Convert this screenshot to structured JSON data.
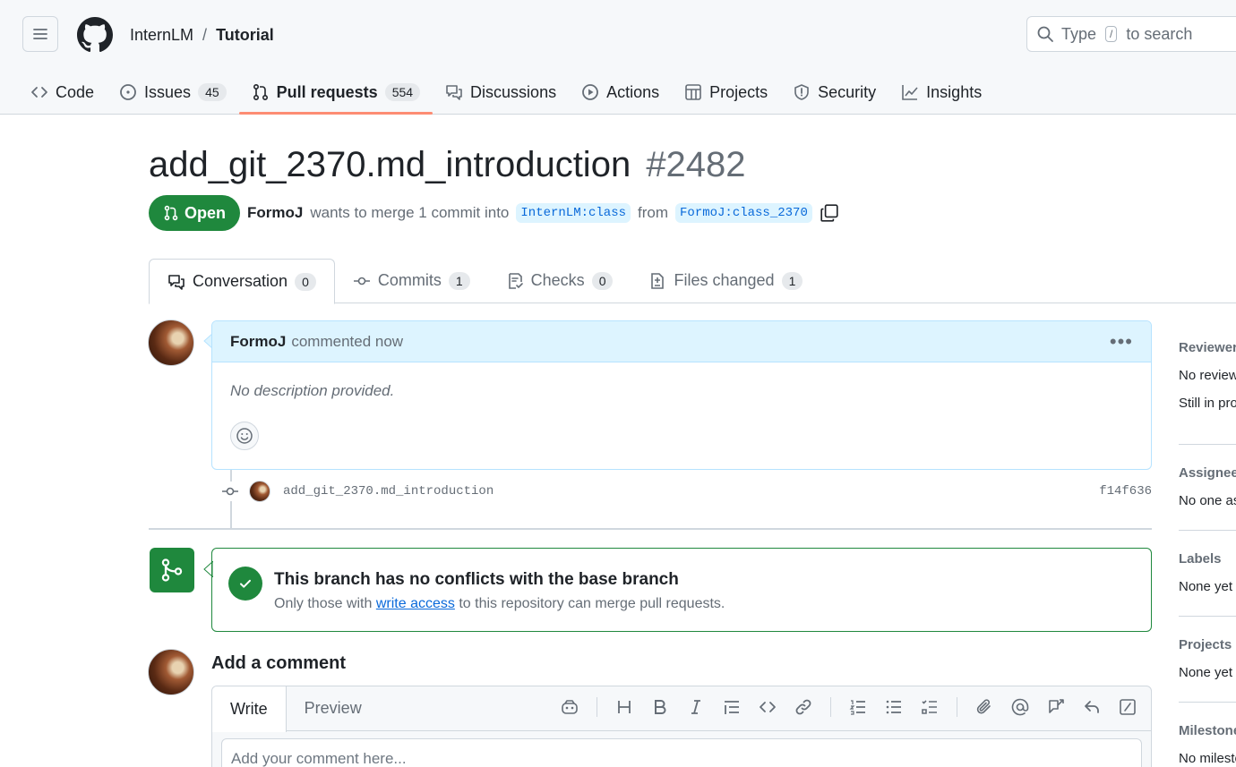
{
  "header": {
    "owner": "InternLM",
    "separator": "/",
    "repo": "Tutorial",
    "search_prefix": "Type",
    "search_key": "/",
    "search_suffix": "to search"
  },
  "nav": [
    {
      "label": "Code",
      "icon": "code-icon"
    },
    {
      "label": "Issues",
      "count": "45",
      "icon": "issue-icon"
    },
    {
      "label": "Pull requests",
      "count": "554",
      "icon": "pull-request-icon",
      "active": true
    },
    {
      "label": "Discussions",
      "icon": "discussions-icon"
    },
    {
      "label": "Actions",
      "icon": "actions-icon"
    },
    {
      "label": "Projects",
      "icon": "projects-icon"
    },
    {
      "label": "Security",
      "icon": "shield-icon"
    },
    {
      "label": "Insights",
      "icon": "graph-icon"
    }
  ],
  "pr": {
    "title": "add_git_2370.md_introduction",
    "number": "#2482",
    "state": "Open",
    "author": "FormoJ",
    "merge_text": "wants to merge 1 commit into",
    "base_branch": "InternLM:class",
    "from_text": "from",
    "head_branch": "FormoJ:class_2370"
  },
  "tabs": [
    {
      "label": "Conversation",
      "count": "0"
    },
    {
      "label": "Commits",
      "count": "1"
    },
    {
      "label": "Checks",
      "count": "0"
    },
    {
      "label": "Files changed",
      "count": "1"
    }
  ],
  "comment": {
    "author": "FormoJ",
    "action": "commented now",
    "body": "No description provided."
  },
  "commit": {
    "message": "add_git_2370.md_introduction",
    "sha": "f14f636"
  },
  "merge": {
    "title": "This branch has no conflicts with the base branch",
    "sub_prefix": "Only those with",
    "sub_link": "write access",
    "sub_suffix": "to this repository can merge pull requests."
  },
  "add_comment": {
    "title": "Add a comment",
    "write_tab": "Write",
    "preview_tab": "Preview",
    "placeholder": "Add your comment here..."
  },
  "sidebar": {
    "reviewers_head": "Reviewers",
    "reviewers_val1": "No reviews",
    "reviewers_val2": "Still in progress?",
    "assignees_head": "Assignees",
    "assignees_val": "No one assigned",
    "labels_head": "Labels",
    "labels_val": "None yet",
    "projects_head": "Projects",
    "projects_val": "None yet",
    "milestone_head": "Milestone",
    "milestone_val": "No milestone"
  },
  "colors": {
    "accent_green": "#1f883d",
    "link_blue": "#0969da",
    "tab_underline": "#fd8c73"
  }
}
